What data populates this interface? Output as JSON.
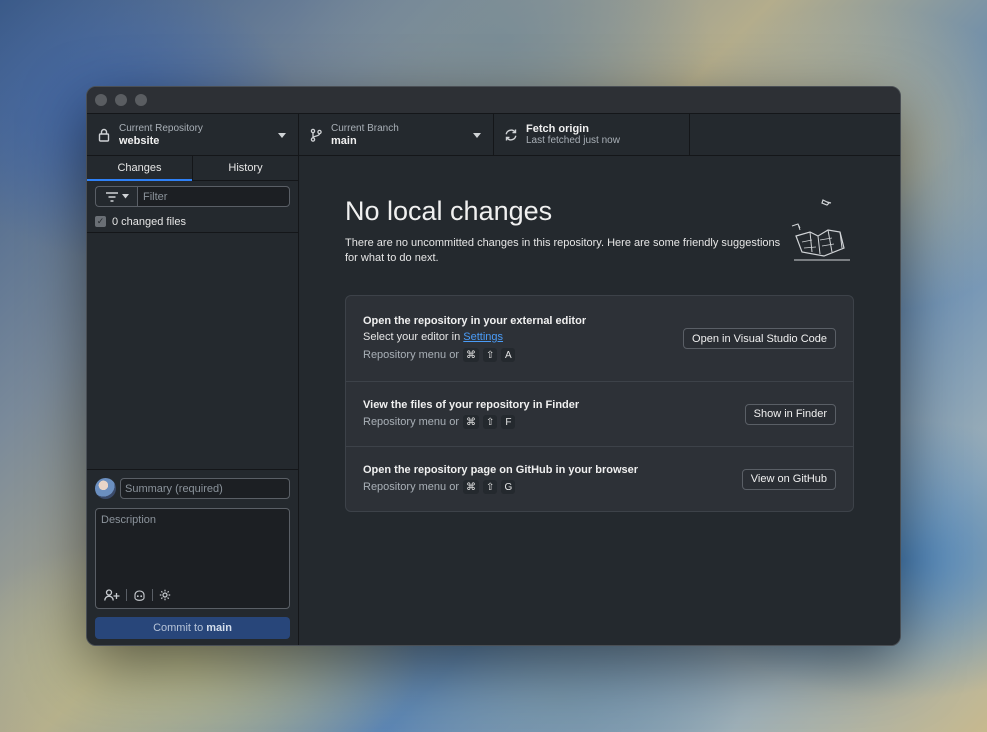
{
  "window": {
    "toolbar": {
      "repository": {
        "label": "Current Repository",
        "value": "website"
      },
      "branch": {
        "label": "Current Branch",
        "value": "main"
      },
      "fetch": {
        "label": "Fetch origin",
        "status": "Last fetched just now"
      }
    },
    "sidebar": {
      "tabs": [
        {
          "label": "Changes",
          "active": true
        },
        {
          "label": "History",
          "active": false
        }
      ],
      "filter": {
        "placeholder": "Filter",
        "value": ""
      },
      "changed_files": "0 changed files",
      "commit": {
        "summary_placeholder": "Summary (required)",
        "description_placeholder": "Description",
        "button_prefix": "Commit to",
        "button_branch": "main"
      }
    },
    "main": {
      "title": "No local changes",
      "subtitle": "There are no uncommitted changes in this repository. Here are some friendly suggestions for what to do next.",
      "cards": [
        {
          "title": "Open the repository in your external editor",
          "line_prefix": "Select your editor in",
          "link": "Settings",
          "shortcut_prefix": "Repository menu or",
          "keys": [
            "⌘",
            "⇧",
            "A"
          ],
          "button": "Open in Visual Studio Code"
        },
        {
          "title": "View the files of your repository in Finder",
          "shortcut_prefix": "Repository menu or",
          "keys": [
            "⌘",
            "⇧",
            "F"
          ],
          "button": "Show in Finder"
        },
        {
          "title": "Open the repository page on GitHub in your browser",
          "shortcut_prefix": "Repository menu or",
          "keys": [
            "⌘",
            "⇧",
            "G"
          ],
          "button": "View on GitHub"
        }
      ]
    },
    "colors": {
      "accent": "#2f81f7",
      "commit_button": "#28467a",
      "background": "#24292e"
    }
  }
}
